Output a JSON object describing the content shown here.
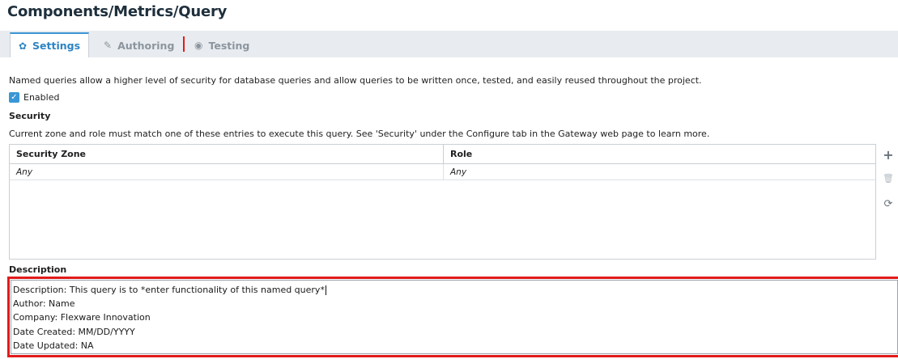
{
  "page": {
    "title": "Components/Metrics/Query"
  },
  "tabs": [
    {
      "label": "Settings",
      "icon": "gear-icon",
      "active": true
    },
    {
      "label": "Authoring",
      "icon": "pencil-icon",
      "active": false
    },
    {
      "label": "Testing",
      "icon": "eye-icon",
      "active": false
    }
  ],
  "settings": {
    "intro": "Named queries allow a higher level of security for database queries and allow queries to be written once, tested, and easily reused throughout the project.",
    "enabled_label": "Enabled",
    "enabled_checked": true,
    "security_heading": "Security",
    "security_description": "Current zone and role must match one of these entries to execute this query. See 'Security' under the Configure tab in the Gateway web page to learn more.",
    "security_table": {
      "columns": [
        "Security Zone",
        "Role"
      ],
      "rows": [
        [
          "Any",
          "Any"
        ]
      ]
    },
    "table_actions": [
      "plus-icon",
      "trash-icon",
      "refresh-icon"
    ],
    "description_heading": "Description",
    "description_lines": [
      "Description: This query is to *enter functionality of this named query*",
      "Author: Name",
      "Company: Flexware Innovation",
      "Date Created: MM/DD/YYYY",
      "Date Updated: NA"
    ]
  },
  "colors": {
    "accent": "#3b95d1",
    "highlight": "#e21b1b",
    "tabbar": "#e8ecf0"
  }
}
